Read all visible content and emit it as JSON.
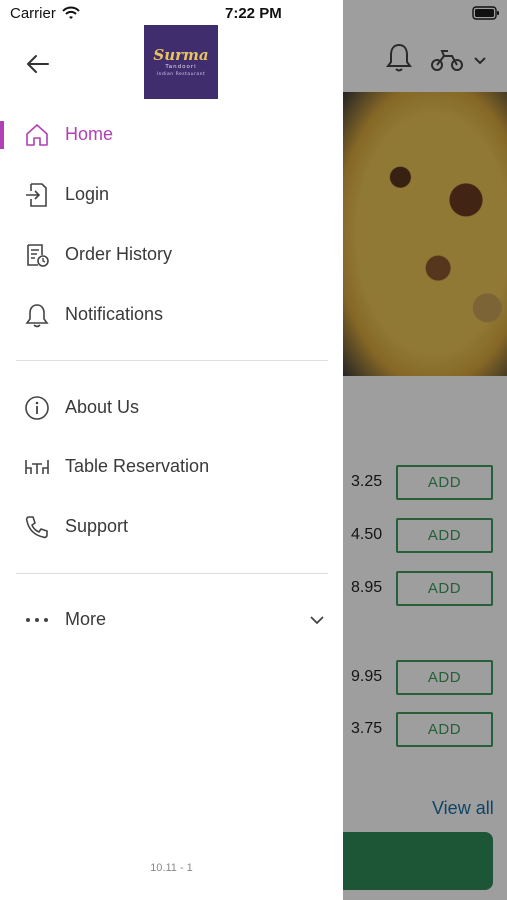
{
  "status_bar": {
    "carrier": "Carrier",
    "time": "7:22 PM"
  },
  "drawer": {
    "logo": {
      "name": "Surma",
      "subtitle": "Tandoori",
      "tagline": "Indian Restaurant"
    },
    "menu": [
      {
        "label": "Home",
        "icon": "home-icon",
        "active": true
      },
      {
        "label": "Login",
        "icon": "login-icon",
        "active": false
      },
      {
        "label": "Order History",
        "icon": "order-history-icon",
        "active": false
      },
      {
        "label": "Notifications",
        "icon": "bell-icon",
        "active": false
      },
      {
        "label": "About Us",
        "icon": "info-icon",
        "active": false
      },
      {
        "label": "Table Reservation",
        "icon": "table-icon",
        "active": false
      },
      {
        "label": "Support",
        "icon": "phone-icon",
        "active": false
      },
      {
        "label": "More",
        "icon": "more-dots-icon",
        "active": false
      }
    ],
    "version": "10.11 - 1"
  },
  "background": {
    "prices": [
      "3.25",
      "4.50",
      "8.95",
      "9.95",
      "3.75"
    ],
    "add_label": "ADD",
    "view_all": "View all"
  },
  "colors": {
    "accent": "#b23fb3",
    "green": "#3e9b5b",
    "logo_bg": "#3f2d6e",
    "link": "#1a6fa5"
  }
}
